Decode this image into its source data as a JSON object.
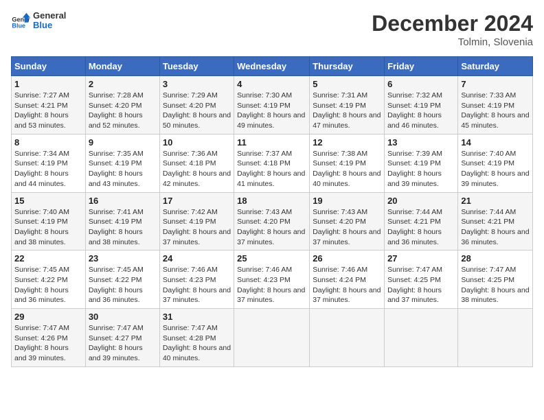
{
  "header": {
    "logo_line1": "General",
    "logo_line2": "Blue",
    "month_title": "December 2024",
    "location": "Tolmin, Slovenia"
  },
  "weekdays": [
    "Sunday",
    "Monday",
    "Tuesday",
    "Wednesday",
    "Thursday",
    "Friday",
    "Saturday"
  ],
  "weeks": [
    [
      {
        "day": "1",
        "sunrise": "Sunrise: 7:27 AM",
        "sunset": "Sunset: 4:21 PM",
        "daylight": "Daylight: 8 hours and 53 minutes."
      },
      {
        "day": "2",
        "sunrise": "Sunrise: 7:28 AM",
        "sunset": "Sunset: 4:20 PM",
        "daylight": "Daylight: 8 hours and 52 minutes."
      },
      {
        "day": "3",
        "sunrise": "Sunrise: 7:29 AM",
        "sunset": "Sunset: 4:20 PM",
        "daylight": "Daylight: 8 hours and 50 minutes."
      },
      {
        "day": "4",
        "sunrise": "Sunrise: 7:30 AM",
        "sunset": "Sunset: 4:19 PM",
        "daylight": "Daylight: 8 hours and 49 minutes."
      },
      {
        "day": "5",
        "sunrise": "Sunrise: 7:31 AM",
        "sunset": "Sunset: 4:19 PM",
        "daylight": "Daylight: 8 hours and 47 minutes."
      },
      {
        "day": "6",
        "sunrise": "Sunrise: 7:32 AM",
        "sunset": "Sunset: 4:19 PM",
        "daylight": "Daylight: 8 hours and 46 minutes."
      },
      {
        "day": "7",
        "sunrise": "Sunrise: 7:33 AM",
        "sunset": "Sunset: 4:19 PM",
        "daylight": "Daylight: 8 hours and 45 minutes."
      }
    ],
    [
      {
        "day": "8",
        "sunrise": "Sunrise: 7:34 AM",
        "sunset": "Sunset: 4:19 PM",
        "daylight": "Daylight: 8 hours and 44 minutes."
      },
      {
        "day": "9",
        "sunrise": "Sunrise: 7:35 AM",
        "sunset": "Sunset: 4:19 PM",
        "daylight": "Daylight: 8 hours and 43 minutes."
      },
      {
        "day": "10",
        "sunrise": "Sunrise: 7:36 AM",
        "sunset": "Sunset: 4:18 PM",
        "daylight": "Daylight: 8 hours and 42 minutes."
      },
      {
        "day": "11",
        "sunrise": "Sunrise: 7:37 AM",
        "sunset": "Sunset: 4:18 PM",
        "daylight": "Daylight: 8 hours and 41 minutes."
      },
      {
        "day": "12",
        "sunrise": "Sunrise: 7:38 AM",
        "sunset": "Sunset: 4:19 PM",
        "daylight": "Daylight: 8 hours and 40 minutes."
      },
      {
        "day": "13",
        "sunrise": "Sunrise: 7:39 AM",
        "sunset": "Sunset: 4:19 PM",
        "daylight": "Daylight: 8 hours and 39 minutes."
      },
      {
        "day": "14",
        "sunrise": "Sunrise: 7:40 AM",
        "sunset": "Sunset: 4:19 PM",
        "daylight": "Daylight: 8 hours and 39 minutes."
      }
    ],
    [
      {
        "day": "15",
        "sunrise": "Sunrise: 7:40 AM",
        "sunset": "Sunset: 4:19 PM",
        "daylight": "Daylight: 8 hours and 38 minutes."
      },
      {
        "day": "16",
        "sunrise": "Sunrise: 7:41 AM",
        "sunset": "Sunset: 4:19 PM",
        "daylight": "Daylight: 8 hours and 38 minutes."
      },
      {
        "day": "17",
        "sunrise": "Sunrise: 7:42 AM",
        "sunset": "Sunset: 4:19 PM",
        "daylight": "Daylight: 8 hours and 37 minutes."
      },
      {
        "day": "18",
        "sunrise": "Sunrise: 7:43 AM",
        "sunset": "Sunset: 4:20 PM",
        "daylight": "Daylight: 8 hours and 37 minutes."
      },
      {
        "day": "19",
        "sunrise": "Sunrise: 7:43 AM",
        "sunset": "Sunset: 4:20 PM",
        "daylight": "Daylight: 8 hours and 37 minutes."
      },
      {
        "day": "20",
        "sunrise": "Sunrise: 7:44 AM",
        "sunset": "Sunset: 4:21 PM",
        "daylight": "Daylight: 8 hours and 36 minutes."
      },
      {
        "day": "21",
        "sunrise": "Sunrise: 7:44 AM",
        "sunset": "Sunset: 4:21 PM",
        "daylight": "Daylight: 8 hours and 36 minutes."
      }
    ],
    [
      {
        "day": "22",
        "sunrise": "Sunrise: 7:45 AM",
        "sunset": "Sunset: 4:22 PM",
        "daylight": "Daylight: 8 hours and 36 minutes."
      },
      {
        "day": "23",
        "sunrise": "Sunrise: 7:45 AM",
        "sunset": "Sunset: 4:22 PM",
        "daylight": "Daylight: 8 hours and 36 minutes."
      },
      {
        "day": "24",
        "sunrise": "Sunrise: 7:46 AM",
        "sunset": "Sunset: 4:23 PM",
        "daylight": "Daylight: 8 hours and 37 minutes."
      },
      {
        "day": "25",
        "sunrise": "Sunrise: 7:46 AM",
        "sunset": "Sunset: 4:23 PM",
        "daylight": "Daylight: 8 hours and 37 minutes."
      },
      {
        "day": "26",
        "sunrise": "Sunrise: 7:46 AM",
        "sunset": "Sunset: 4:24 PM",
        "daylight": "Daylight: 8 hours and 37 minutes."
      },
      {
        "day": "27",
        "sunrise": "Sunrise: 7:47 AM",
        "sunset": "Sunset: 4:25 PM",
        "daylight": "Daylight: 8 hours and 37 minutes."
      },
      {
        "day": "28",
        "sunrise": "Sunrise: 7:47 AM",
        "sunset": "Sunset: 4:25 PM",
        "daylight": "Daylight: 8 hours and 38 minutes."
      }
    ],
    [
      {
        "day": "29",
        "sunrise": "Sunrise: 7:47 AM",
        "sunset": "Sunset: 4:26 PM",
        "daylight": "Daylight: 8 hours and 39 minutes."
      },
      {
        "day": "30",
        "sunrise": "Sunrise: 7:47 AM",
        "sunset": "Sunset: 4:27 PM",
        "daylight": "Daylight: 8 hours and 39 minutes."
      },
      {
        "day": "31",
        "sunrise": "Sunrise: 7:47 AM",
        "sunset": "Sunset: 4:28 PM",
        "daylight": "Daylight: 8 hours and 40 minutes."
      },
      null,
      null,
      null,
      null
    ]
  ]
}
